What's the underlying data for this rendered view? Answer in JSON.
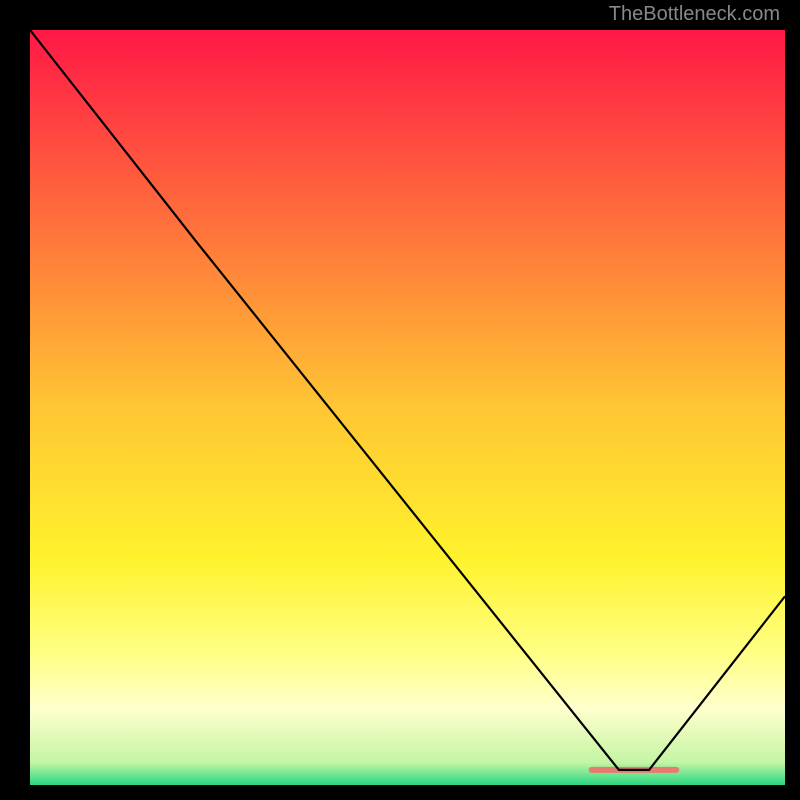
{
  "watermark": "TheBottleneck.com",
  "chart_data": {
    "type": "line",
    "title": "",
    "xlabel": "",
    "ylabel": "",
    "xlim": [
      0,
      100
    ],
    "ylim": [
      0,
      100
    ],
    "x": [
      0,
      22,
      78,
      82,
      100
    ],
    "values": [
      100,
      72,
      2,
      2,
      25
    ],
    "gradient_stops": [
      {
        "offset": 0.0,
        "color": "#ff1846"
      },
      {
        "offset": 0.25,
        "color": "#ff6e3c"
      },
      {
        "offset": 0.5,
        "color": "#ffc633"
      },
      {
        "offset": 0.7,
        "color": "#fff22d"
      },
      {
        "offset": 0.82,
        "color": "#ffff80"
      },
      {
        "offset": 0.9,
        "color": "#ffffcd"
      },
      {
        "offset": 0.97,
        "color": "#c4f5a4"
      },
      {
        "offset": 1.0,
        "color": "#27d880"
      }
    ],
    "marker": {
      "x_start": 74,
      "x_end": 86,
      "y": 2,
      "color": "#e77b71"
    },
    "line_color": "#000000",
    "background": "#000000"
  }
}
